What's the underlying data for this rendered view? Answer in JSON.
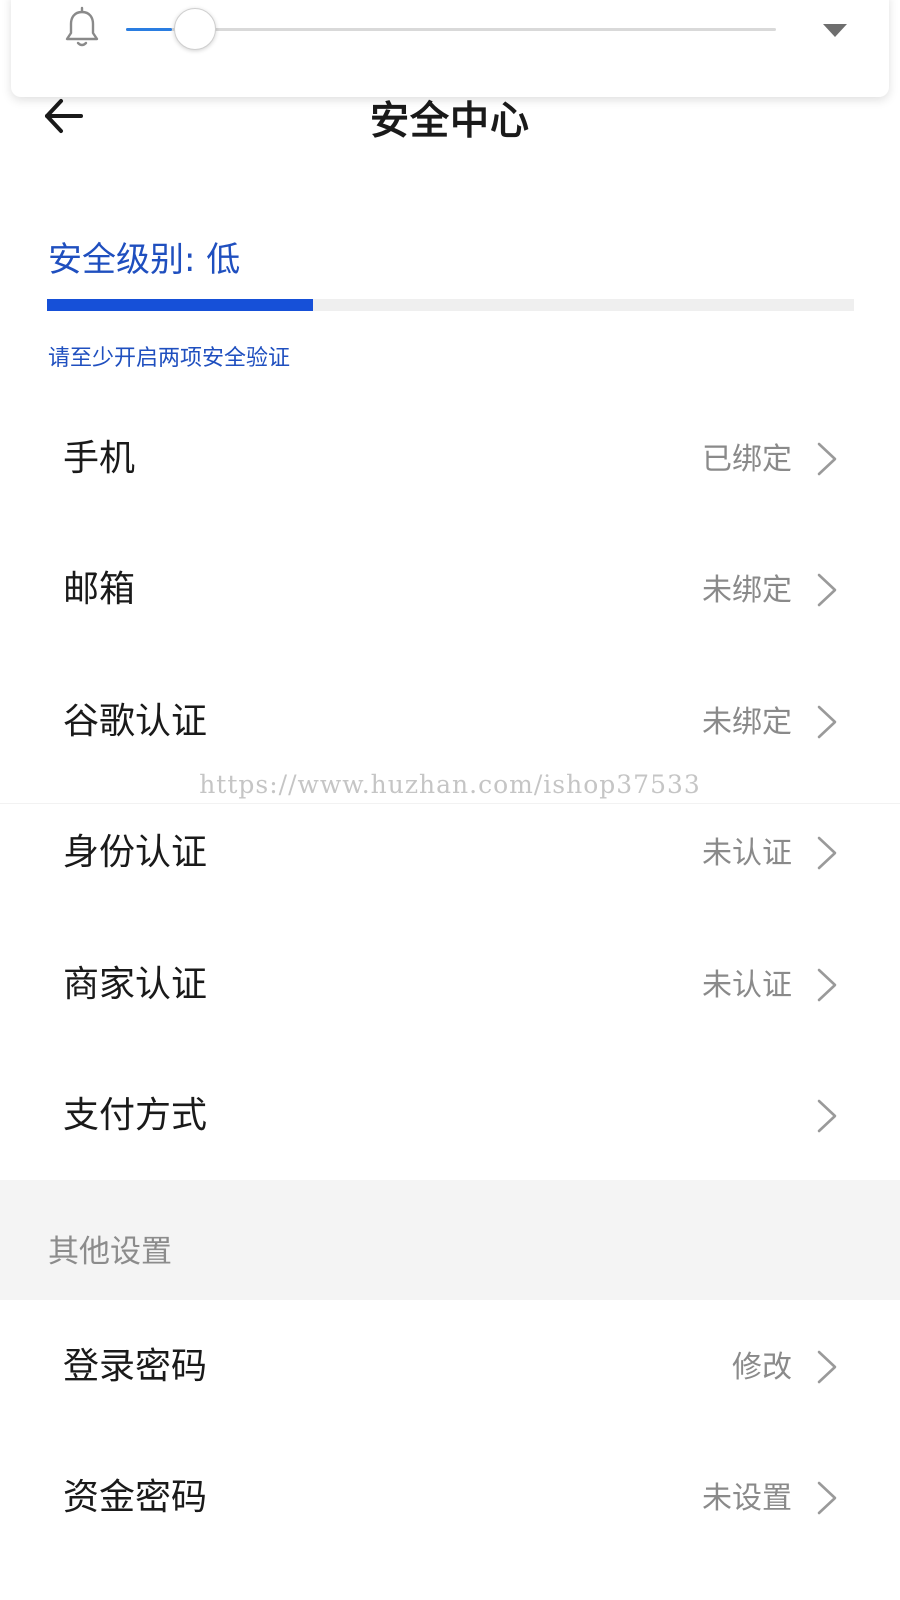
{
  "volume": {
    "level": 0.07,
    "colors": {
      "fill": "#2a7de1",
      "track": "#d9d9d9"
    },
    "icons": {
      "bell": "bell-icon",
      "expand": "triangle-down-icon"
    }
  },
  "header": {
    "title": "安全中心",
    "back_icon": "arrow-left-icon"
  },
  "security": {
    "level_label": "安全级别: 低",
    "level_progress": 0.33,
    "hint": "请至少开启两项安全验证",
    "color": "#1650d8"
  },
  "rows": [
    {
      "label": "手机",
      "value": "已绑定"
    },
    {
      "label": "邮箱",
      "value": "未绑定"
    },
    {
      "label": "谷歌认证",
      "value": "未绑定"
    },
    {
      "label": "身份认证",
      "value": "未认证"
    },
    {
      "label": "商家认证",
      "value": "未认证"
    },
    {
      "label": "支付方式",
      "value": ""
    }
  ],
  "other_section": {
    "title": "其他设置",
    "rows": [
      {
        "label": "登录密码",
        "value": "修改"
      },
      {
        "label": "资金密码",
        "value": "未设置"
      }
    ]
  },
  "watermark": "https://www.huzhan.com/ishop37533"
}
